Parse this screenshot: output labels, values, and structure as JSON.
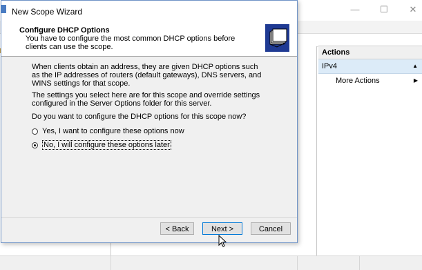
{
  "window": {
    "minimize_glyph": "—",
    "maximize_glyph": "☐",
    "close_glyph": "✕"
  },
  "actions_pane": {
    "header": "Actions",
    "group_label": "IPv4",
    "group_caret": "▲",
    "items": [
      {
        "label": "More Actions",
        "arrow": "▶"
      }
    ]
  },
  "wizard": {
    "title": "New Scope Wizard",
    "header_title": "Configure DHCP Options",
    "header_subtitle": "You have to configure the most common DHCP options before clients can use the scope.",
    "paragraph1": "When clients obtain an address, they are given DHCP options such as the IP addresses of routers (default gateways), DNS servers, and WINS settings for that scope.",
    "paragraph2": "The settings you select here are for this scope and override settings configured in the Server Options folder for this server.",
    "question": "Do you want to configure the DHCP options for this scope now?",
    "options": [
      {
        "label": "Yes, I want to configure these options now",
        "selected": false
      },
      {
        "label": "No, I will configure these options later",
        "selected": true
      }
    ],
    "buttons": {
      "back": "< Back",
      "next": "Next >",
      "cancel": "Cancel"
    }
  },
  "colors": {
    "accent_blue": "#0078d7",
    "selection_blue": "#dcebf8",
    "dialog_border": "#6f93c7",
    "header_icon_bg": "#1f3a93"
  },
  "icons": {
    "header": "folder-stack-icon",
    "title": "wizard-app-icon",
    "cursor": "mouse-pointer-icon"
  }
}
